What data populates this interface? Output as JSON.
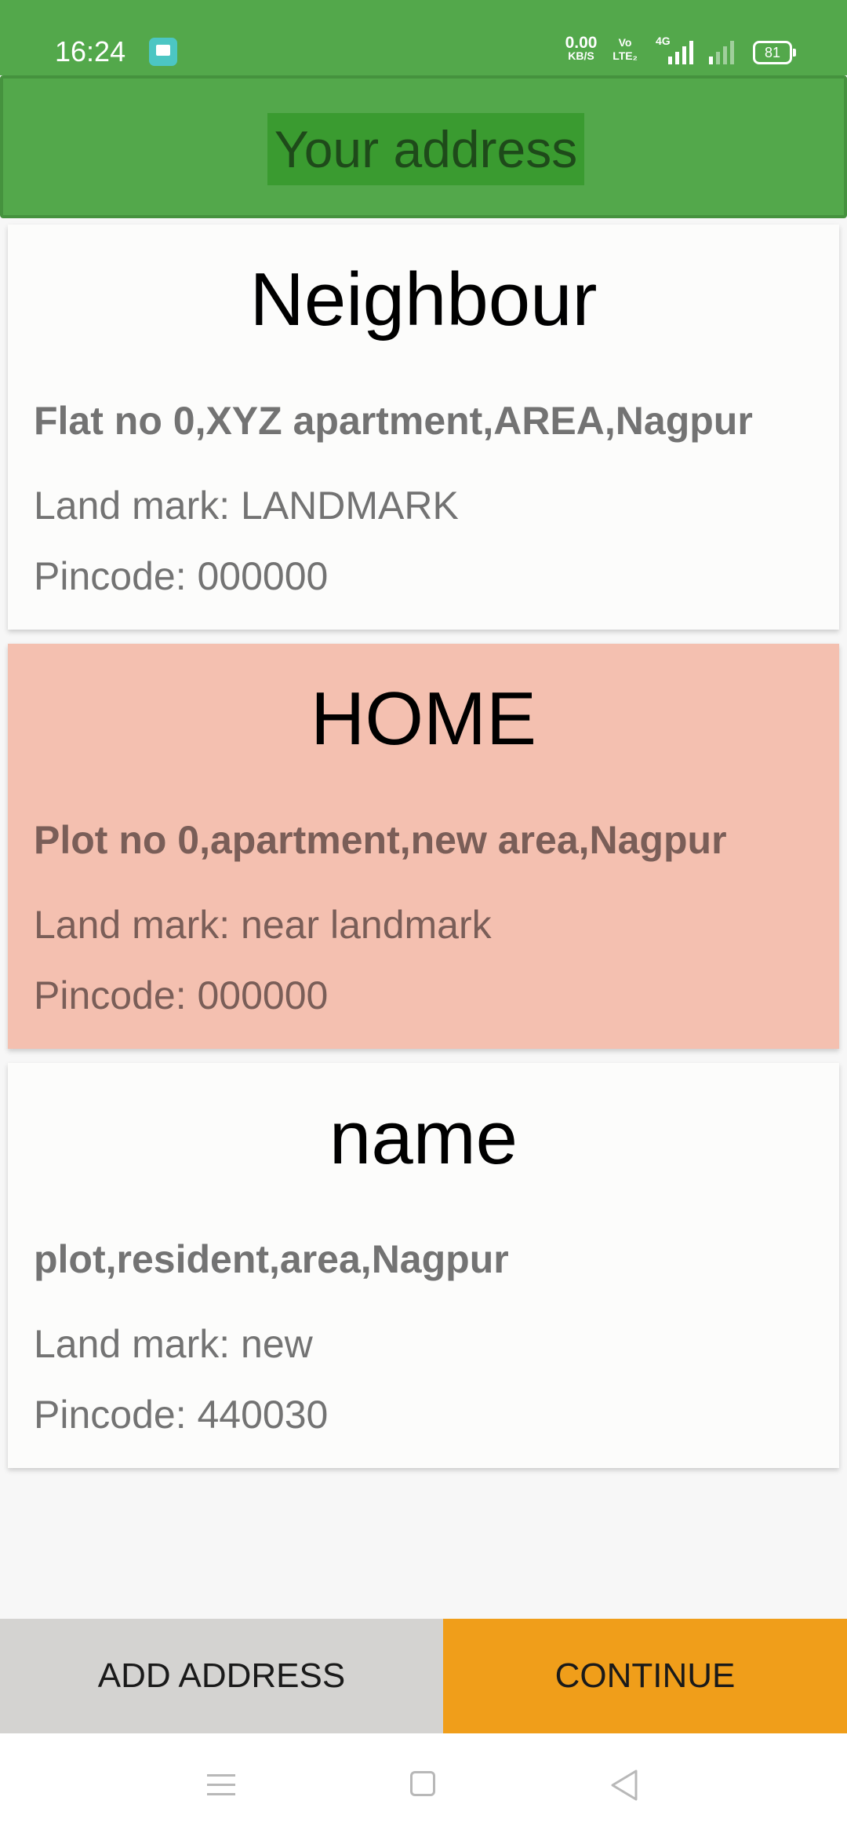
{
  "status_bar": {
    "time": "16:24",
    "net_speed_value": "0.00",
    "net_speed_unit": "KB/S",
    "volte_top": "Vo",
    "volte_bottom": "LTE₂",
    "network_type": "4G",
    "battery": "81",
    "icons": [
      "message-icon",
      "signal-icon",
      "battery-icon"
    ]
  },
  "header": {
    "title": "Your address"
  },
  "addresses": [
    {
      "name": "Neighbour",
      "address": "Flat no 0,XYZ apartment,AREA,Nagpur",
      "landmark": "Land mark: LANDMARK",
      "pincode": "Pincode: 000000",
      "selected": false
    },
    {
      "name": "HOME",
      "address": "Plot no 0,apartment,new area,Nagpur",
      "landmark": "Land mark: near landmark",
      "pincode": "Pincode: 000000",
      "selected": true
    },
    {
      "name": "name",
      "address": "plot,resident,area,Nagpur",
      "landmark": "Land mark: new",
      "pincode": "Pincode: 440030",
      "selected": false
    }
  ],
  "actions": {
    "add_address": "ADD ADDRESS",
    "continue": "CONTINUE"
  },
  "nav_bar": {
    "icons": [
      "menu-icon",
      "home-icon",
      "back-icon"
    ]
  },
  "colors": {
    "header_green": "#53a84b",
    "selected_card": "#f4c0b0",
    "continue_orange": "#f09e1a",
    "add_grey": "#d4d3d1"
  }
}
